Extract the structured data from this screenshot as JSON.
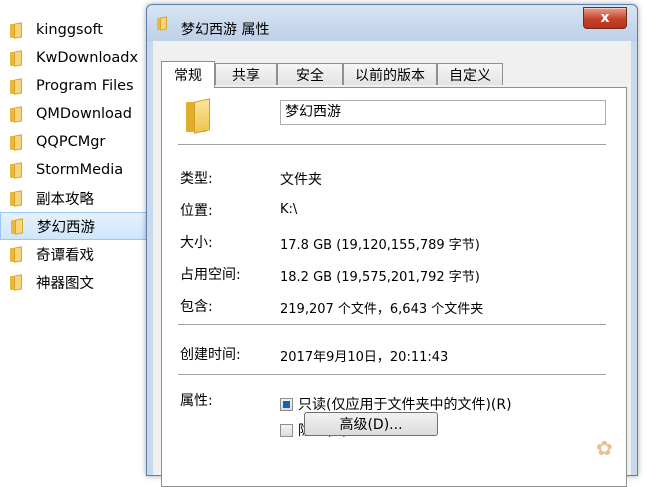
{
  "explorer": {
    "items": [
      {
        "label": "kinggsoft"
      },
      {
        "label": "KwDownloadx"
      },
      {
        "label": "Program Files"
      },
      {
        "label": "QMDownload"
      },
      {
        "label": "QQPCMgr"
      },
      {
        "label": "StormMedia"
      },
      {
        "label": "副本攻略"
      },
      {
        "label": "梦幻西游"
      },
      {
        "label": "奇谭看戏"
      },
      {
        "label": "神器图文"
      }
    ],
    "selected_index": 7
  },
  "dialog": {
    "title": "梦幻西游 属性",
    "close_label": "x",
    "tabs": [
      {
        "label": "常规"
      },
      {
        "label": "共享"
      },
      {
        "label": "安全"
      },
      {
        "label": "以前的版本"
      },
      {
        "label": "自定义"
      }
    ],
    "active_tab": "常规",
    "folder_name": "梦幻西游",
    "props": {
      "type_label": "类型:",
      "type_value": "文件夹",
      "location_label": "位置:",
      "location_value": "K:\\",
      "size_label": "大小:",
      "size_value": "17.8 GB (19,120,155,789 字节)",
      "disk_size_label": "占用空间:",
      "disk_size_value": "18.2 GB (19,575,201,792 字节)",
      "contains_label": "包含:",
      "contains_value": "219,207 个文件，6,643 个文件夹",
      "created_label": "创建时间:",
      "created_value": "2017年9月10日，20:11:43",
      "attributes_label": "属性:",
      "readonly_label": "只读(仅应用于文件夹中的文件)(R)",
      "hidden_label": "隐藏(H)",
      "advanced_label": "高级(D)..."
    }
  }
}
